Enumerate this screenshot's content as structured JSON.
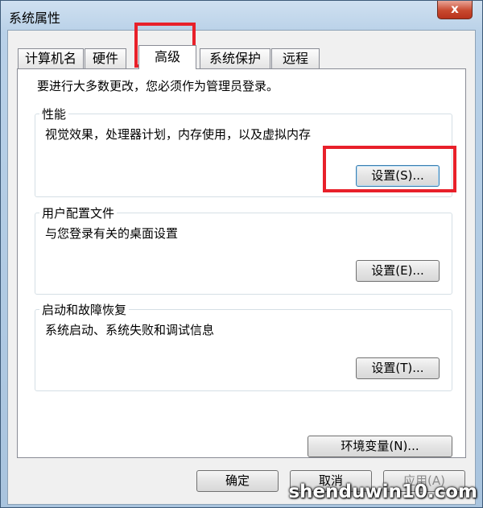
{
  "window": {
    "title": "系统属性",
    "close": "x"
  },
  "tabs": [
    {
      "label": "计算机名"
    },
    {
      "label": "硬件"
    },
    {
      "label": "高级"
    },
    {
      "label": "系统保护"
    },
    {
      "label": "远程"
    }
  ],
  "active_tab": "高级",
  "advanced": {
    "intro": "要进行大多数更改，您必须作为管理员登录。",
    "performance": {
      "title": "性能",
      "desc": "视觉效果，处理器计划，内存使用，以及虚拟内存",
      "button": "设置(S)..."
    },
    "profiles": {
      "title": "用户配置文件",
      "desc": "与您登录有关的桌面设置",
      "button": "设置(E)..."
    },
    "startup": {
      "title": "启动和故障恢复",
      "desc": "系统启动、系统失败和调试信息",
      "button": "设置(T)..."
    },
    "env_button": "环境变量(N)..."
  },
  "footer": {
    "ok": "确定",
    "cancel": "取消",
    "apply": "应用(A)"
  },
  "watermark": "shenduwin10.com",
  "highlight_color": "#e8202a"
}
